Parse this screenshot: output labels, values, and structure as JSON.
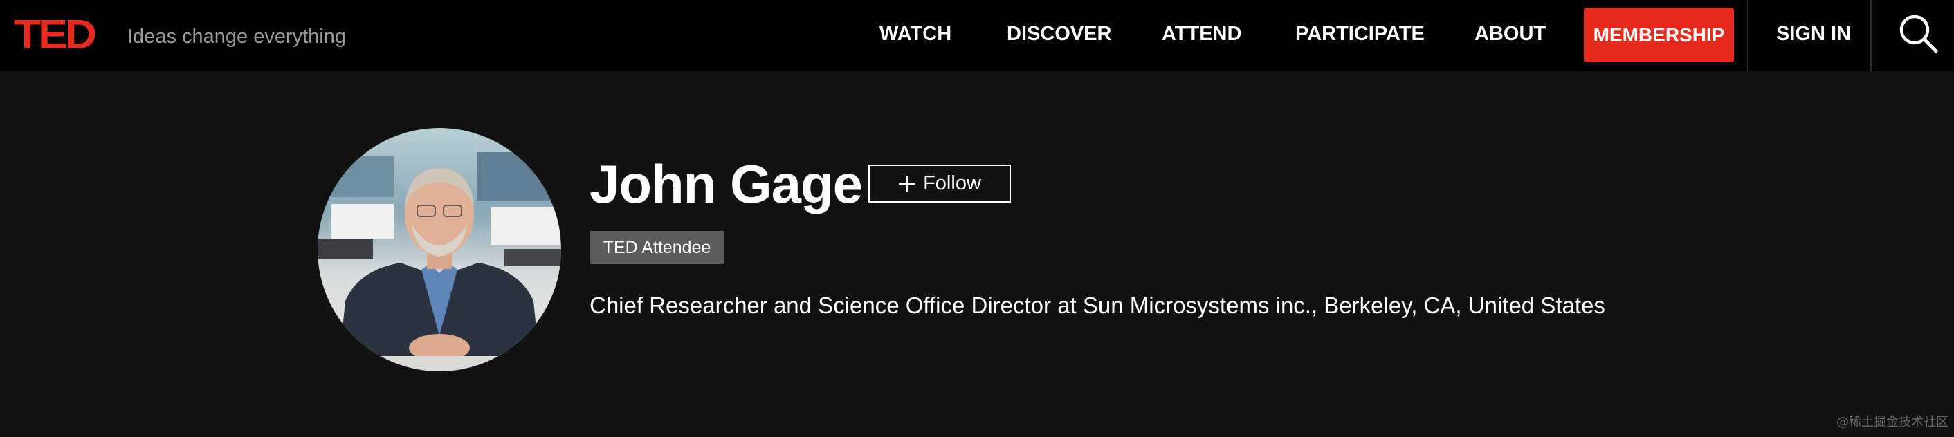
{
  "header": {
    "logo_text": "TED",
    "tagline": "Ideas change everything",
    "nav": {
      "watch": "WATCH",
      "discover": "DISCOVER",
      "attend": "ATTEND",
      "participate": "PARTICIPATE",
      "about": "ABOUT",
      "membership": "MEMBERSHIP",
      "sign_in": "SIGN IN"
    },
    "search_icon": "search-icon"
  },
  "profile": {
    "name": "John Gage",
    "follow_label": "Follow",
    "badge": "TED Attendee",
    "bio": "Chief Researcher and Science Office Director at Sun Microsystems inc., Berkeley, CA, United States"
  },
  "watermark": "@稀土掘金技术社区",
  "colors": {
    "brand_red": "#e62b1e",
    "header_bg": "#000000",
    "page_bg": "#121212",
    "badge_bg": "#5c5c5c"
  }
}
